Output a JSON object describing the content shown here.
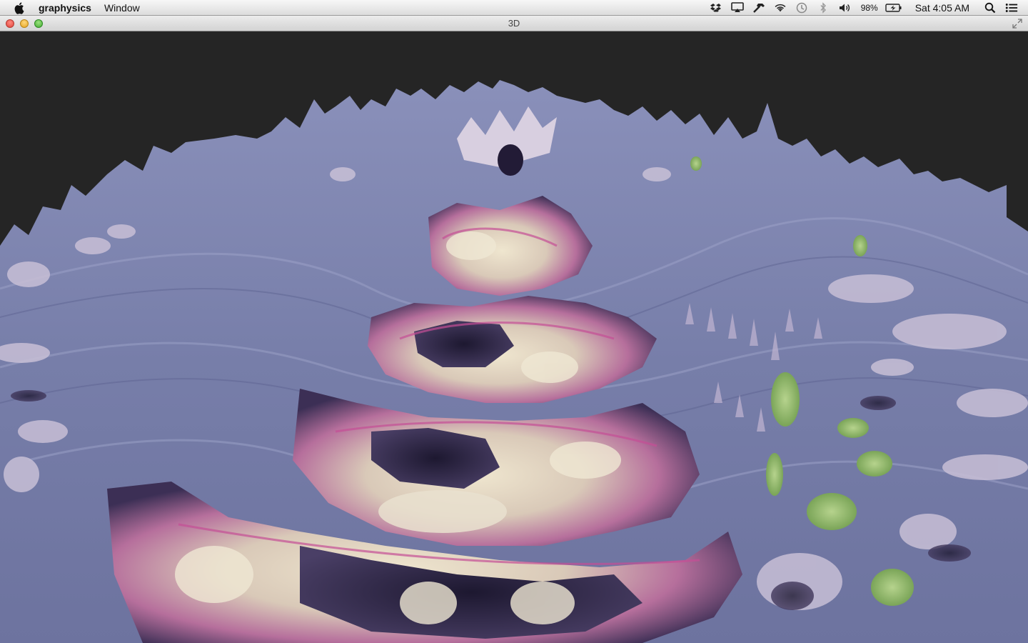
{
  "menubar": {
    "app_name": "graphysics",
    "items": [
      "Window"
    ],
    "battery_percent": "98%",
    "clock": "Sat 4:05 AM",
    "icons": [
      "apple-icon",
      "dropbox-icon",
      "airplay-icon",
      "hammer-icon",
      "wifi-icon",
      "time-machine-icon",
      "bluetooth-icon",
      "volume-icon",
      "battery-icon",
      "spotlight-icon",
      "notification-center-icon"
    ]
  },
  "window": {
    "title": "3D"
  },
  "scene": {
    "background_color": "#252525",
    "surface_color": "#7a80ac",
    "accent_colors": [
      "#e9ddc2",
      "#c46fa6",
      "#2a2440",
      "#8fb36a"
    ]
  }
}
